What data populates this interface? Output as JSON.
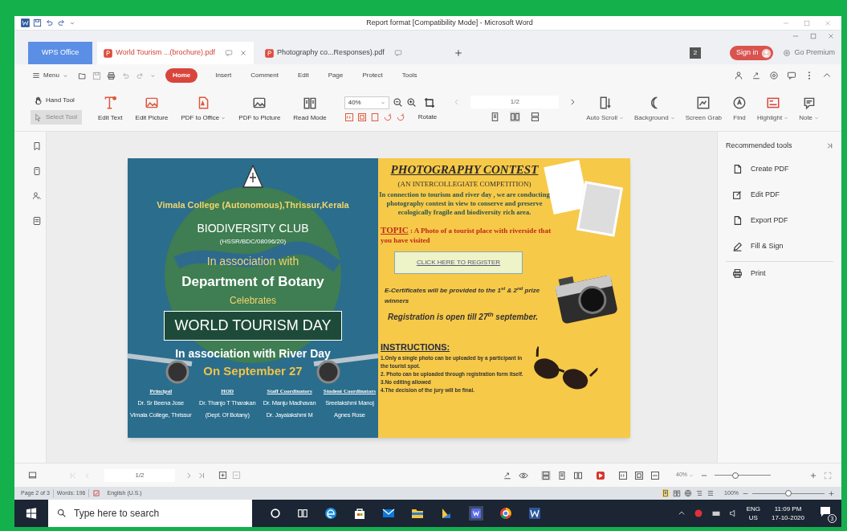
{
  "word_title_bar": {
    "title": "Report format [Compatibility Mode] - Microsoft Word"
  },
  "app_tab": {
    "label": "WPS Office"
  },
  "tabs": [
    {
      "label": "World Tourism ...(brochure).pdf",
      "selected": true
    },
    {
      "label": "Photography co...Responses).pdf",
      "selected": false
    }
  ],
  "account": {
    "badge": "2",
    "sign_in": "Sign in",
    "premium": "Go Premium"
  },
  "menu": {
    "label": "Menu",
    "items": [
      {
        "label": "Home",
        "selected": true
      },
      {
        "label": "Insert",
        "selected": false
      },
      {
        "label": "Comment",
        "selected": false
      },
      {
        "label": "Edit",
        "selected": false
      },
      {
        "label": "Page",
        "selected": false
      },
      {
        "label": "Protect",
        "selected": false
      },
      {
        "label": "Tools",
        "selected": false
      }
    ]
  },
  "toolbar": {
    "modes": [
      {
        "label": "Hand Tool",
        "selected": false
      },
      {
        "label": "Select Tool",
        "selected": true
      }
    ],
    "actions_left": [
      {
        "label": "Edit Text",
        "dropdown": false
      },
      {
        "label": "Edit Picture",
        "dropdown": false
      },
      {
        "label": "PDF to Office",
        "dropdown": true
      },
      {
        "label": "PDF to Picture",
        "dropdown": false
      },
      {
        "label": "Read Mode",
        "dropdown": false
      }
    ],
    "zoom": "40%",
    "rotate": "Rotate",
    "page": "1/2",
    "actions_right": [
      {
        "label": "Auto Scroll",
        "dropdown": true
      },
      {
        "label": "Background",
        "dropdown": true
      },
      {
        "label": "Screen Grab",
        "dropdown": false
      },
      {
        "label": "Find",
        "dropdown": false
      },
      {
        "label": "Highlight",
        "dropdown": true
      },
      {
        "label": "Note",
        "dropdown": true
      }
    ]
  },
  "document": {
    "poster": {
      "college": "Vimala College (Autonomous),Thrissur,Kerala",
      "club": "BIODIVERSITY CLUB",
      "registration": "(HSSR/BDC/08096/20)",
      "association": "In association with",
      "department": "Department of Botany",
      "celebrates": "Celebrates",
      "event": "WORLD TOURISM DAY",
      "river_day": "In association with River Day",
      "date": "On September 27",
      "credits": [
        {
          "heading": "Principal",
          "lines": [
            "Dr. Sr Beena Jose",
            "Vimala College, Thrissur"
          ]
        },
        {
          "heading": "HOD",
          "lines": [
            "Dr. Thanjo T Tharakan",
            "(Dept. Of Botany)"
          ]
        },
        {
          "heading": "Staff Coordinators",
          "lines": [
            "Dr. Manju Madhavan",
            "Dr. Jayalakshmi M"
          ]
        },
        {
          "heading": "Student Coordinators",
          "lines": [
            "Sreelakshmi Manoj",
            "Agnes Rose"
          ]
        }
      ]
    },
    "contest": {
      "title": "PHOTOGRAPHY CONTEST",
      "subtitle": "(AN INTERCOLLEGIATE COMPETITION)",
      "intro": "In connection to tourism and river day , we are conducting photography  contest  in view to conserve and  preserve ecologically fragile and biodiversity rich area.",
      "topic_label": "TOPIC",
      "topic": ":  A  Photo of a tourist place with riverside that you have visited",
      "register": "CLICK HERE TO REGISTER",
      "certificates": "E-Certificates will be provided to the 1$^{st}$ & 2$^{nd}$ prize winners",
      "deadline": "Registration is open till  27$^{th}$ september.",
      "instructions_title": "INSTRUCTIONS:",
      "instructions": [
        "1.Only a single photo can be uploaded by a  participant in the tourist  spot.",
        "2. Photo can  be uploaded through registration form itself.",
        "3.No editing allowed",
        "4.The decision of the jury will be final."
      ]
    }
  },
  "recommended_tools": {
    "title": "Recommended tools",
    "items": [
      "Create PDF",
      "Edit PDF",
      "Export PDF",
      "Fill & Sign"
    ],
    "footer_item": "Print"
  },
  "page_bar": {
    "page": "1/2",
    "zoom": "40%",
    "zoom_slider": {
      "level": 0.35
    }
  },
  "word_status": {
    "page": "Page 2 of 3",
    "words": "Words: 196",
    "language": "English (U.S.)",
    "zoom": "100%",
    "zoom_slider": {
      "level": 0.5
    }
  },
  "taskbar": {
    "search": {
      "placeholder": "Type here to search"
    },
    "language": "ENG",
    "region": "US",
    "time": "11:09 PM",
    "date": "17-10-2020",
    "notifications": "3"
  }
}
